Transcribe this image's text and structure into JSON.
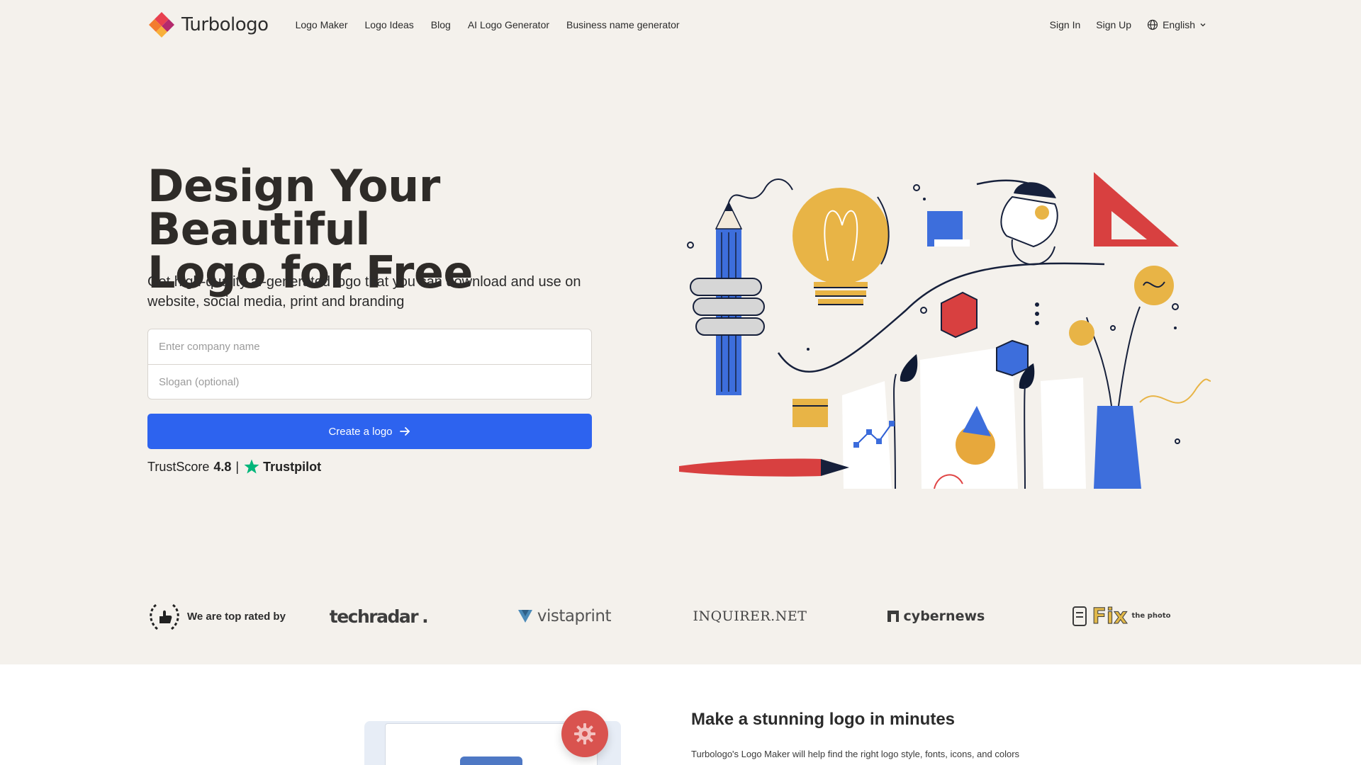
{
  "brand": {
    "name": "Turbologo",
    "colors": {
      "mark_top": "#e8404f",
      "mark_left": "#f37c2f",
      "mark_right": "#b42a6d",
      "mark_bottom": "#f8b03b"
    }
  },
  "nav": {
    "links": [
      "Logo Maker",
      "Logo Ideas",
      "Blog",
      "AI Logo Generator",
      "Business name generator"
    ],
    "sign_in": "Sign In",
    "sign_up": "Sign Up",
    "language": "English",
    "language_icon": "globe-icon"
  },
  "hero": {
    "title_line1": "Design Your Beautiful",
    "title_line2": "Logo for Free",
    "subtitle": "Get high-quality ai-generated logo that you can download and use on website, social media, print and branding",
    "company_placeholder": "Enter company name",
    "slogan_placeholder": "Slogan (optional)",
    "cta_label": "Create a logo",
    "cta_color": "#2d63ef",
    "background": "#f4f1ec"
  },
  "trust": {
    "label": "TrustScore",
    "score": "4.8",
    "separator": "|",
    "provider": "Trustpilot",
    "star_color": "#00b67a"
  },
  "press": {
    "label": "We are top rated by",
    "logos": [
      "techradar",
      "vistaprint",
      "INQUIRER.NET",
      "cybernews",
      "Fix",
      "the photo"
    ]
  },
  "section2": {
    "title": "Make a stunning logo in minutes",
    "text": "Turbologo's Logo Maker will help find the right logo style, fonts, icons, and colors"
  }
}
